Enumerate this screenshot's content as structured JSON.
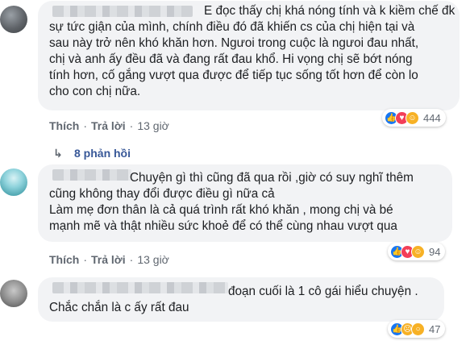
{
  "comments": [
    {
      "text": "E đọc thấy chị khá nóng tính và k kiềm chế đk\nsự tức giận của mình, chính điều đó đã khiến cs của chị hiện tại và\nsau này trở nên khó khăn hơn. Ngưoi trong cuộc là ngưoi đau nhất,\nchị và anh ấy đều đã và đang rất đau khổ. Hi vọng chị sẽ bớt nóng\ntính hơn, cố gắng vượt qua được để tiếp tục sống tốt hơn để còn lo\ncho con chị nữa.",
      "like_label": "Thích",
      "reply_label": "Trả lời",
      "time": "13 giờ",
      "reaction_icons": [
        "like-icon",
        "heart-icon",
        "care-icon"
      ],
      "reaction_count": "444",
      "replies_label": "8 phản hồi"
    },
    {
      "text": "Chuyện gì thì cũng đã qua rồi ,giờ có suy nghĩ thêm\ncũng không thay đổi được điều gì nữa cả\nLàm mẹ đơn thân là cả quá trình rất khó khăn , mong chị và bé\nmạnh mẽ và thật nhiều sức khoẻ để có thể cùng nhau vượt qua",
      "like_label": "Thích",
      "reply_label": "Trả lời",
      "time": "13 giờ",
      "reaction_icons": [
        "like-icon",
        "heart-icon",
        "care-icon"
      ],
      "reaction_count": "94"
    },
    {
      "text": "đoạn cuối là 1 cô gái hiểu chuyện .\nChắc chắn là c ấy rất đau",
      "like_label": "Thích",
      "reply_label": "Trả lời",
      "time": "13 giờ",
      "reaction_icons": [
        "like-icon",
        "sad-icon",
        "wow-icon"
      ],
      "reaction_count": "47"
    }
  ],
  "colors": {
    "bubble": "#f2f3f5",
    "link": "#385898",
    "meta": "#606770",
    "like": "#1877f2",
    "heart": "#f33e58",
    "yellow": "#f7b125"
  }
}
